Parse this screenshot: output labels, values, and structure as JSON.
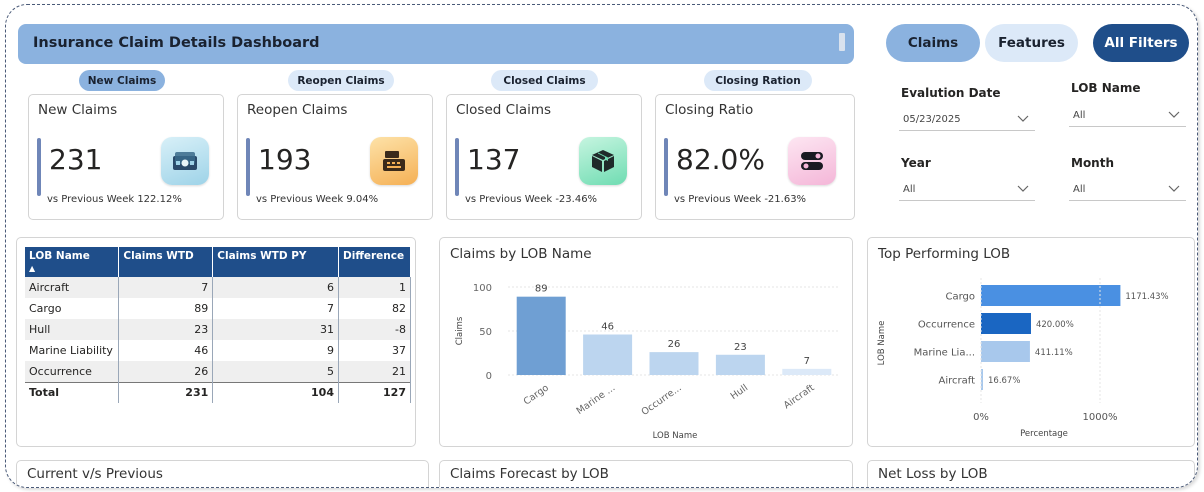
{
  "header": {
    "title": "Insurance Claim Details Dashboard"
  },
  "nav": {
    "claims": "Claims",
    "features": "Features",
    "all_filters": "All Filters"
  },
  "kpi_tabs": [
    "New Claims",
    "Reopen Claims",
    "Closed Claims",
    "Closing Ration"
  ],
  "kpis": [
    {
      "label": "New Claims",
      "value": "231",
      "sub": "vs Previous Week 122.12%",
      "icon": "money-icon"
    },
    {
      "label": "Reopen Claims",
      "value": "193",
      "sub": "vs Previous Week 9.04%",
      "icon": "cash-register-icon"
    },
    {
      "label": "Closed Claims",
      "value": "137",
      "sub": "vs Previous Week -23.46%",
      "icon": "box-icon"
    },
    {
      "label": "Closing Ratio",
      "value": "82.0%",
      "sub": "vs Previous Week -21.63%",
      "icon": "toggle-icon"
    }
  ],
  "filters": {
    "evaluation_date": {
      "label": "Evalution Date",
      "value": "05/23/2025"
    },
    "lob_name": {
      "label": "LOB Name",
      "value": "All"
    },
    "year": {
      "label": "Year",
      "value": "All"
    },
    "month": {
      "label": "Month",
      "value": "All"
    }
  },
  "table": {
    "headers": [
      "LOB Name",
      "Claims WTD",
      "Claims WTD PY",
      "Difference"
    ],
    "rows": [
      [
        "Aircraft",
        "7",
        "6",
        "1"
      ],
      [
        "Cargo",
        "89",
        "7",
        "82"
      ],
      [
        "Hull",
        "23",
        "31",
        "-8"
      ],
      [
        "Marine Liability",
        "46",
        "9",
        "37"
      ],
      [
        "Occurrence",
        "26",
        "5",
        "21"
      ]
    ],
    "total": [
      "Total",
      "231",
      "104",
      "127"
    ]
  },
  "bottom_titles": [
    "Current v/s Previous",
    "Claims Forecast by LOB",
    "Net Loss by LOB"
  ],
  "chart_data": [
    {
      "type": "bar",
      "title": "Claims by LOB Name",
      "xlabel": "LOB Name",
      "ylabel": "Claims",
      "categories": [
        "Cargo",
        "Marine ...",
        "Occurre...",
        "Hull",
        "Aircraft"
      ],
      "values": [
        89,
        46,
        26,
        23,
        7
      ],
      "yticks": [
        "0",
        "50",
        "100"
      ],
      "ylim": [
        0,
        100
      ],
      "colors": [
        "#6f9fd3",
        "#bcd5ef",
        "#bcd5ef",
        "#bcd5ef",
        "#dce9f8"
      ]
    },
    {
      "type": "bar",
      "orientation": "horizontal",
      "title": "Top Performing LOB",
      "xlabel": "Percentage",
      "ylabel": "LOB Name",
      "categories": [
        "Cargo",
        "Occurrence",
        "Marine Lia...",
        "Aircraft"
      ],
      "values": [
        1171.43,
        420.0,
        411.11,
        16.67
      ],
      "labels": [
        "1171.43%",
        "420.00%",
        "411.11%",
        "16.67%"
      ],
      "xticks": [
        "0%",
        "1000%"
      ],
      "xlim": [
        0,
        1000
      ],
      "colors": [
        "#4a90e2",
        "#1a66c2",
        "#a8c8ec",
        "#a8c8ec"
      ]
    }
  ]
}
